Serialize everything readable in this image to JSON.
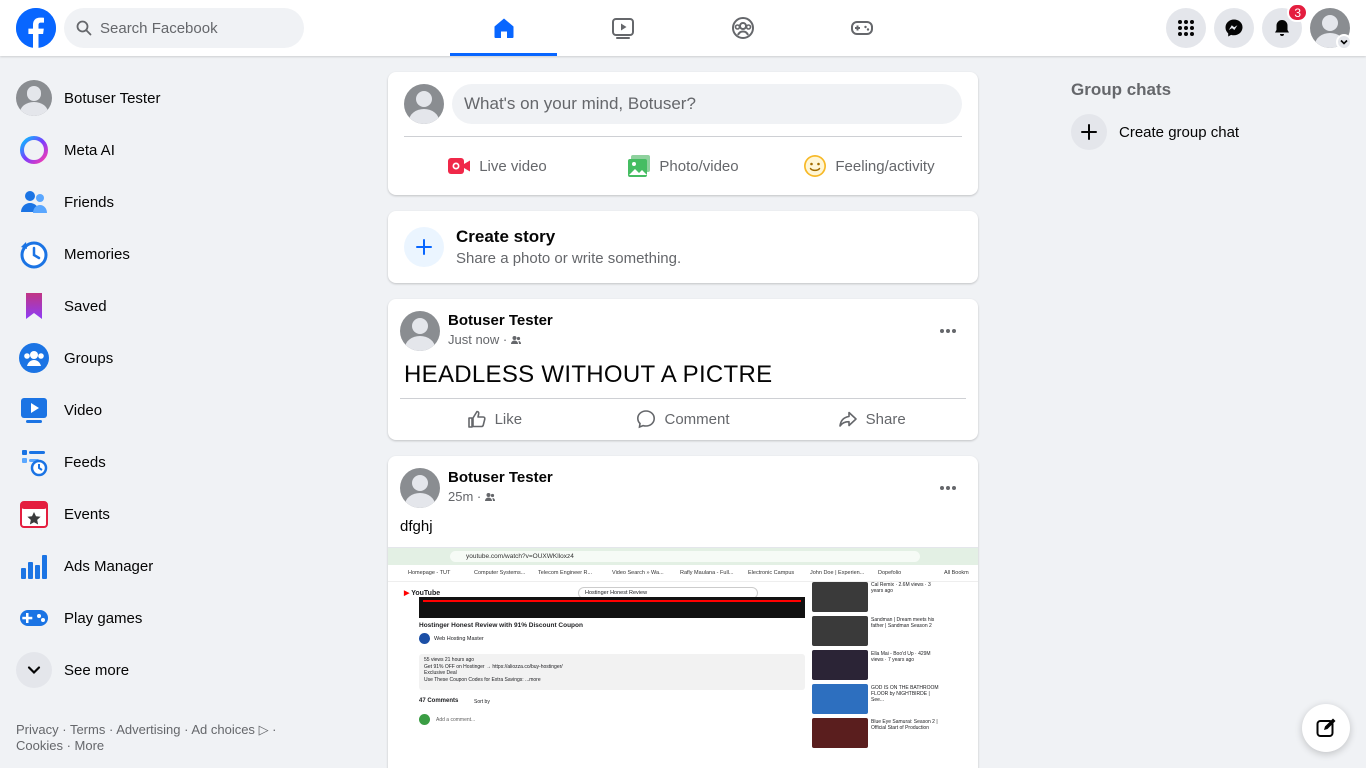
{
  "header": {
    "search_placeholder": "Search Facebook",
    "notifications_count": "3",
    "brand_color": "#0866ff"
  },
  "sidebar": {
    "items": [
      {
        "label": "Botuser Tester",
        "icon": "profile-avatar"
      },
      {
        "label": "Meta AI",
        "icon": "meta-ai-icon"
      },
      {
        "label": "Friends",
        "icon": "friends-icon"
      },
      {
        "label": "Memories",
        "icon": "memories-icon"
      },
      {
        "label": "Saved",
        "icon": "saved-icon"
      },
      {
        "label": "Groups",
        "icon": "groups-icon"
      },
      {
        "label": "Video",
        "icon": "video-icon"
      },
      {
        "label": "Feeds",
        "icon": "feeds-icon"
      },
      {
        "label": "Events",
        "icon": "events-icon"
      },
      {
        "label": "Ads Manager",
        "icon": "ads-manager-icon"
      },
      {
        "label": "Play games",
        "icon": "play-games-icon"
      },
      {
        "label": "See more",
        "icon": "chevron-down-icon"
      }
    ],
    "footer": [
      "Privacy",
      "Terms",
      "Advertising",
      "Ad choices",
      "Cookies",
      "More"
    ]
  },
  "composer": {
    "placeholder": "What's on your mind, Botuser?",
    "actions": [
      "Live video",
      "Photo/video",
      "Feeling/activity"
    ]
  },
  "story": {
    "title": "Create story",
    "subtitle": "Share a photo or write something."
  },
  "posts": [
    {
      "author": "Botuser Tester",
      "time": "Just now",
      "text": "HEADLESS WITHOUT A PICTRE",
      "actions": [
        "Like",
        "Comment",
        "Share"
      ]
    },
    {
      "author": "Botuser Tester",
      "time": "25m",
      "text": "dfghj",
      "screenshot": {
        "url": "youtube.com/watch?v=OUXWKlloxz4",
        "bookmarks": [
          "Homepage - TUT",
          "Computer Systems...",
          "Telecom Engineer R...",
          "Video Search » Wa...",
          "Rafly Maulana - Full...",
          "Electronic Campus",
          "John Doe | Experien...",
          "Dopefolio",
          "All Bookm"
        ],
        "search_query": "Hostinger Honest Review",
        "video_title": "Hostinger Honest Review with 91% Discount Coupon",
        "channel": "Web Hosting Master",
        "description": [
          "55 views  21 hours ago",
          "Get 91% OFF on Hostinger → https://aliozza.co/buy-hostinger/",
          "Exclusive Deal",
          "Use These Coupon Codes for Extra Savings: ...more"
        ],
        "comments_count": "47 Comments",
        "sort_by": "Sort by",
        "add_comment": "Add a comment...",
        "suggestions": [
          "Cal Remix · 2.6M views · 3 years ago",
          "Sandman | Dream meets his father | Sandman Season 2",
          "Ella Mai - Boo'd Up · 429M views · 7 years ago",
          "GOD IS ON THE BATHROOM FLOOR by NIGHTBIRDE | See...",
          "Blue Eye Samurai: Season 2 | Official Start of Production"
        ]
      }
    }
  ],
  "right": {
    "title": "Group chats",
    "create_label": "Create group chat"
  }
}
